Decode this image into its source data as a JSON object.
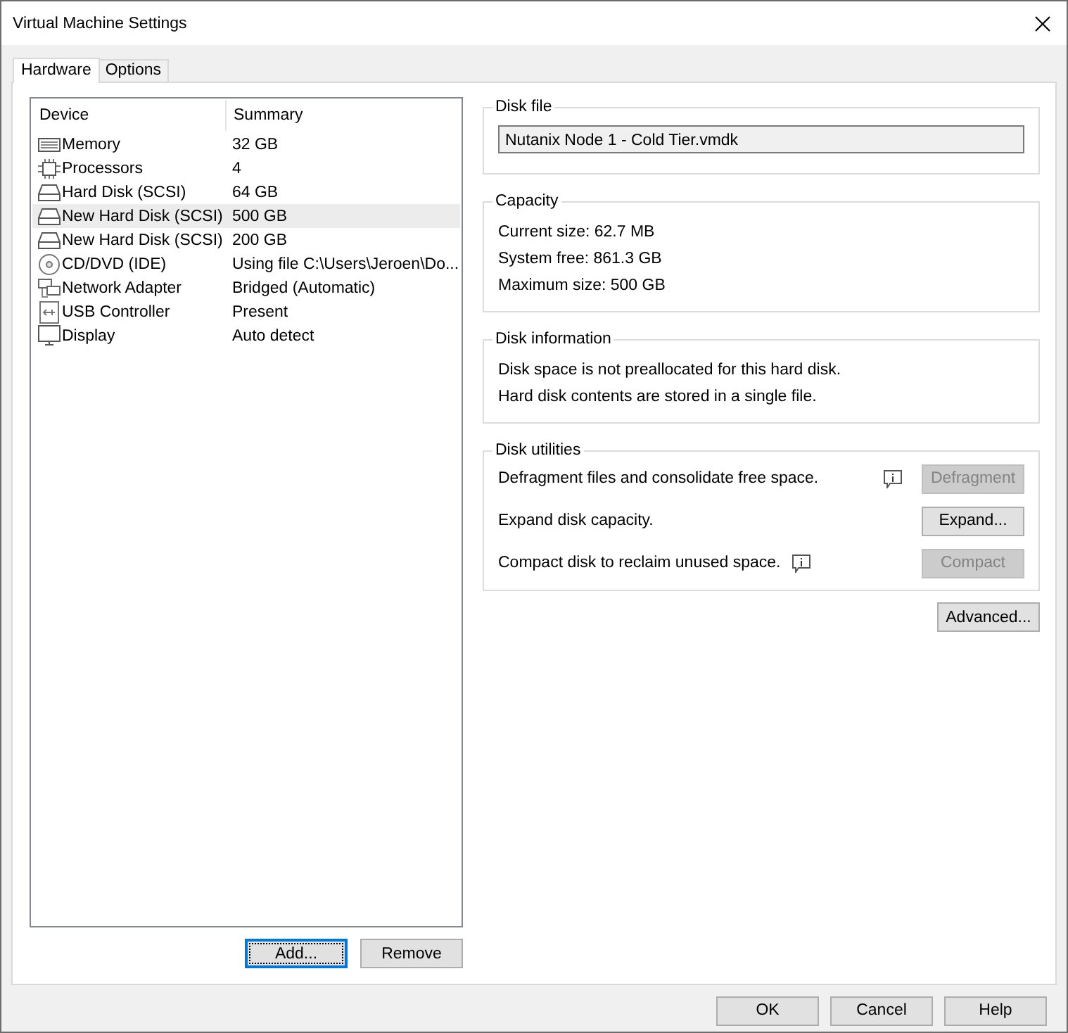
{
  "window": {
    "title": "Virtual Machine Settings"
  },
  "tabs": [
    {
      "label": "Hardware",
      "selected": true
    },
    {
      "label": "Options",
      "selected": false
    }
  ],
  "device_list": {
    "columns": [
      "Device",
      "Summary"
    ],
    "rows": [
      {
        "kind": "memory",
        "device": "Memory",
        "summary": "32 GB",
        "selected": false
      },
      {
        "kind": "processor",
        "device": "Processors",
        "summary": "4",
        "selected": false
      },
      {
        "kind": "disk",
        "device": "Hard Disk (SCSI)",
        "summary": "64 GB",
        "selected": false
      },
      {
        "kind": "disk",
        "device": "New Hard Disk (SCSI)",
        "summary": "500 GB",
        "selected": true
      },
      {
        "kind": "disk",
        "device": "New Hard Disk (SCSI)",
        "summary": "200 GB",
        "selected": false
      },
      {
        "kind": "cdrom",
        "device": "CD/DVD (IDE)",
        "summary": "Using file C:\\Users\\Jeroen\\Do...",
        "selected": false
      },
      {
        "kind": "network",
        "device": "Network Adapter",
        "summary": "Bridged (Automatic)",
        "selected": false
      },
      {
        "kind": "usb",
        "device": "USB Controller",
        "summary": "Present",
        "selected": false
      },
      {
        "kind": "display",
        "device": "Display",
        "summary": "Auto detect",
        "selected": false
      }
    ]
  },
  "list_buttons": [
    {
      "label": "Add...",
      "focused": true
    },
    {
      "label": "Remove",
      "focused": false
    }
  ],
  "disk_file": {
    "title": "Disk file",
    "value": "Nutanix Node 1 - Cold Tier.vmdk"
  },
  "capacity": {
    "title": "Capacity",
    "lines": [
      "Current size: 62.7 MB",
      "System free: 861.3 GB",
      "Maximum size: 500 GB"
    ]
  },
  "disk_information": {
    "title": "Disk information",
    "lines": [
      "Disk space is not preallocated for this hard disk.",
      "Hard disk contents are stored in a single file."
    ]
  },
  "disk_utilities": {
    "title": "Disk utilities",
    "items": [
      {
        "text": "Defragment files and consolidate free space.",
        "info_beside_button": true,
        "info_after_text": false,
        "button": "Defragment",
        "disabled": true
      },
      {
        "text": "Expand disk capacity.",
        "info_beside_button": false,
        "info_after_text": false,
        "button": "Expand...",
        "disabled": false
      },
      {
        "text": "Compact disk to reclaim unused space.",
        "info_beside_button": false,
        "info_after_text": true,
        "button": "Compact",
        "disabled": true
      }
    ]
  },
  "advanced_button": {
    "label": "Advanced..."
  },
  "dialog_buttons": [
    "OK",
    "Cancel",
    "Help"
  ]
}
